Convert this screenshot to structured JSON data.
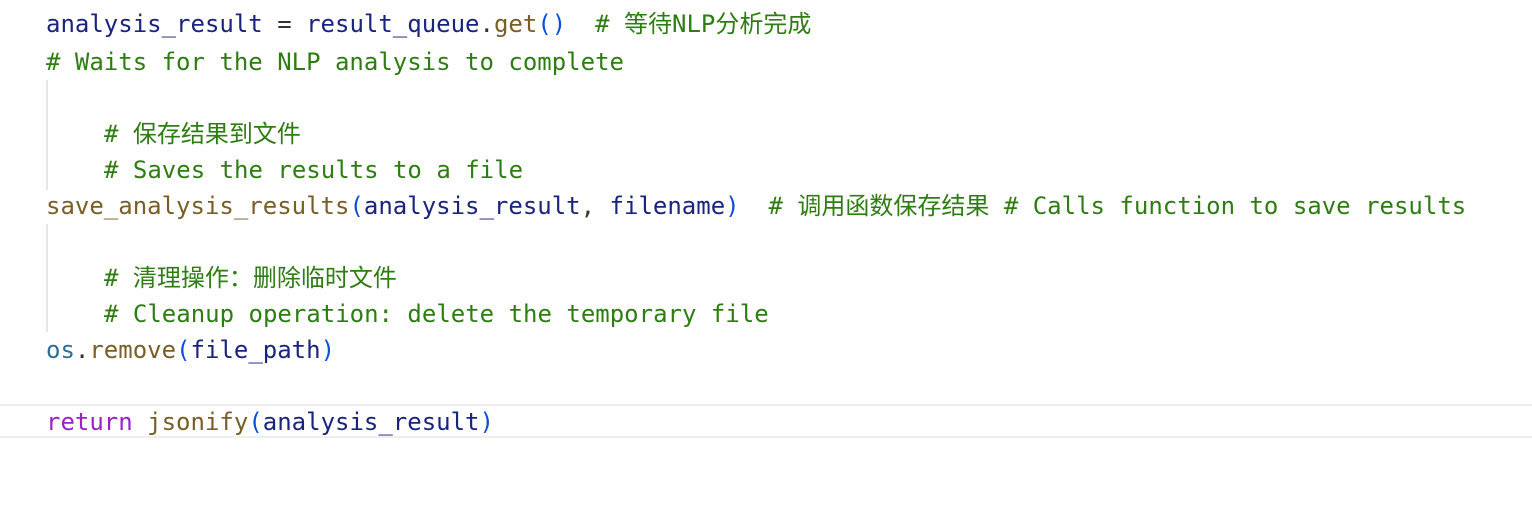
{
  "colors": {
    "background": "#ffffff",
    "variable": "#1a237e",
    "function": "#795e26",
    "paren": "#0b4fd6",
    "comment": "#2e7d12",
    "keyword": "#9a20c8",
    "module": "#2a6f97"
  },
  "lines": {
    "l1": {
      "var": "analysis_result",
      "eq": " = ",
      "obj": "result_queue",
      "dot": ".",
      "fn": "get",
      "parens": "()",
      "comment": "  # 等待NLP分析完成"
    },
    "l2": {
      "comment": "# Waits for the NLP analysis to complete"
    },
    "l4": {
      "comment": "# 保存结果到文件"
    },
    "l5": {
      "comment": "# Saves the results to a file"
    },
    "l6": {
      "fn": "save_analysis_results",
      "open": "(",
      "arg1": "analysis_result",
      "comma": ", ",
      "arg2": "filename",
      "close": ")",
      "comment": "  # 调用函数保存结果 # Calls function to save results"
    },
    "l8": {
      "comment": "# 清理操作：删除临时文件"
    },
    "l9": {
      "comment": "# Cleanup operation: delete the temporary file"
    },
    "l10": {
      "mod": "os",
      "dot": ".",
      "fn": "remove",
      "open": "(",
      "arg": "file_path",
      "close": ")"
    },
    "l12": {
      "kw": "return",
      "space": " ",
      "fn": "jsonify",
      "open": "(",
      "arg": "analysis_result",
      "close": ")"
    }
  }
}
